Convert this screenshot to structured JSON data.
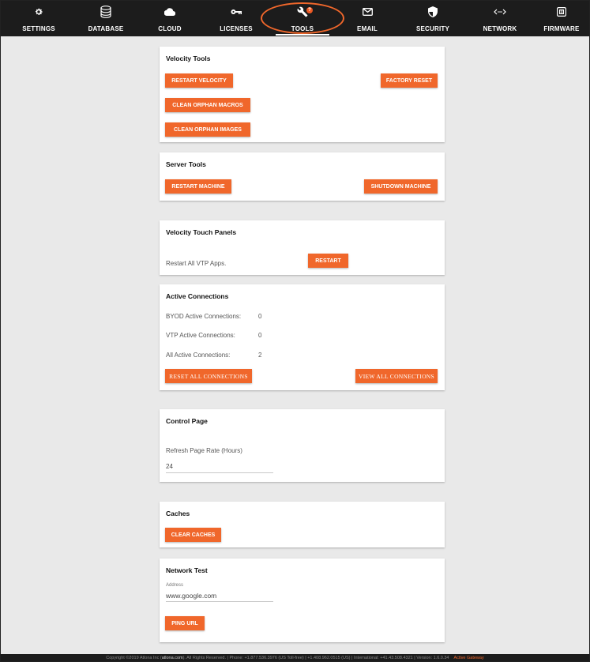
{
  "nav": {
    "items": [
      {
        "label": "SETTINGS",
        "icon": "gear-icon"
      },
      {
        "label": "DATABASE",
        "icon": "database-icon"
      },
      {
        "label": "CLOUD",
        "icon": "cloud-icon"
      },
      {
        "label": "LICENSES",
        "icon": "key-icon"
      },
      {
        "label": "TOOLS",
        "icon": "wrench-icon",
        "badge": "?"
      },
      {
        "label": "EMAIL",
        "icon": "mail-icon"
      },
      {
        "label": "SECURITY",
        "icon": "shield-icon"
      },
      {
        "label": "NETWORK",
        "icon": "network-icon"
      },
      {
        "label": "FIRMWARE",
        "icon": "firmware-icon"
      }
    ],
    "active": "TOOLS"
  },
  "velocity_tools": {
    "title": "Velocity Tools",
    "restart_velocity": "RESTART VELOCITY",
    "factory_reset": "FACTORY RESET",
    "clean_orphan_macros": "CLEAN ORPHAN MACROS",
    "clean_orphan_images": "CLEAN ORPHAN IMAGES"
  },
  "server_tools": {
    "title": "Server Tools",
    "restart_machine": "RESTART MACHINE",
    "shutdown_machine": "SHUTDOWN MACHINE"
  },
  "touch_panels": {
    "title": "Velocity Touch Panels",
    "description": "Restart All VTP Apps.",
    "restart": "RESTART"
  },
  "connections": {
    "title": "Active Connections",
    "rows": [
      {
        "label": "BYOD Active Connections:",
        "value": "0"
      },
      {
        "label": "VTP Active Connections:",
        "value": "0"
      },
      {
        "label": "All Active Connections:",
        "value": "2"
      }
    ],
    "reset_all": "RESET ALL CONNECTIONS",
    "view_all": "VIEW ALL CONNECTIONS"
  },
  "control_page": {
    "title": "Control Page",
    "field_label": "Refresh Page Rate (Hours)",
    "field_value": "24"
  },
  "caches": {
    "title": "Caches",
    "clear": "CLEAR CACHES"
  },
  "network_test": {
    "title": "Network Test",
    "address_label": "Address",
    "address_value": "www.google.com",
    "ping": "PING URL"
  },
  "footer": {
    "copyright": "Copyright ©2019 Atlona Inc (",
    "link": "atlona.com",
    "rest": "). All Rights Reserved. | Phone: +1.877.536.3976 (US Toll-free) | +1.408.962.0515 (US) | International: +41.43.508.4321 | Version: 1.6.0.34",
    "gateway": "Active Gateway"
  },
  "colors": {
    "accent": "#f0672b",
    "nav_bg": "#1c1c1c",
    "page_bg": "#e9e9e9"
  }
}
